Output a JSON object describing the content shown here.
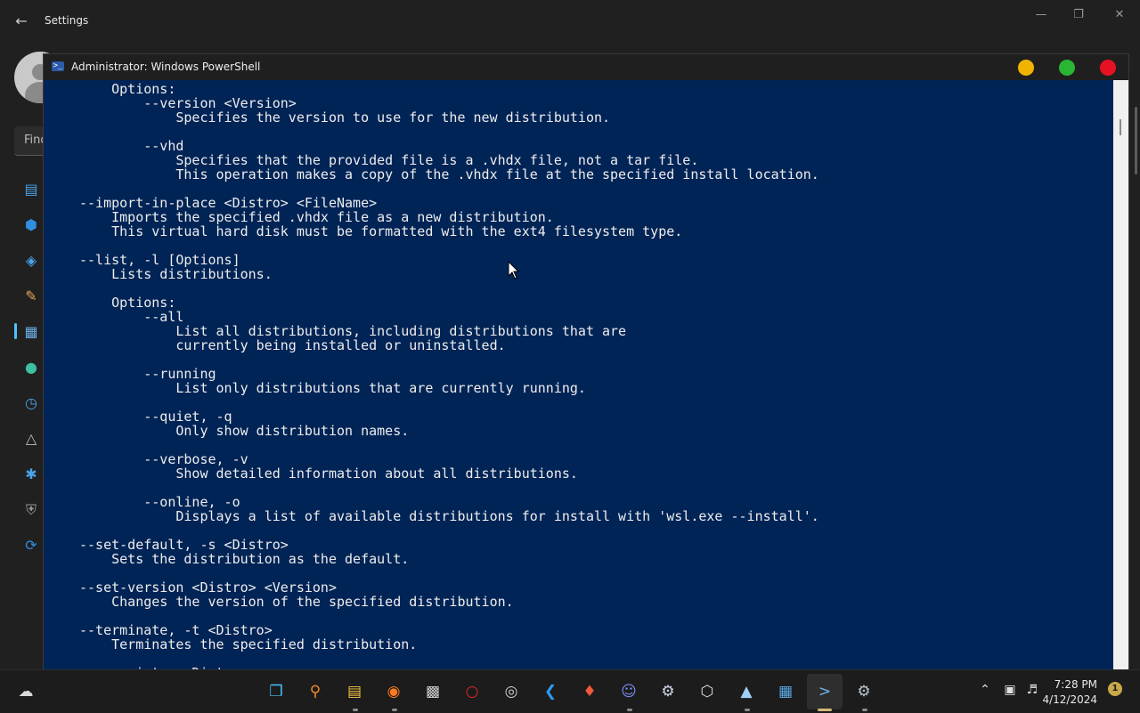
{
  "settings": {
    "title": "Settings",
    "search_placeholder": "Find"
  },
  "powershell": {
    "title": "Administrator: Windows PowerShell",
    "lines": [
      "    Options:",
      "        --version <Version>",
      "            Specifies the version to use for the new distribution.",
      "",
      "        --vhd",
      "            Specifies that the provided file is a .vhdx file, not a tar file.",
      "            This operation makes a copy of the .vhdx file at the specified install location.",
      "",
      "--import-in-place <Distro> <FileName>",
      "    Imports the specified .vhdx file as a new distribution.",
      "    This virtual hard disk must be formatted with the ext4 filesystem type.",
      "",
      "--list, -l [Options]",
      "    Lists distributions.",
      "",
      "    Options:",
      "        --all",
      "            List all distributions, including distributions that are",
      "            currently being installed or uninstalled.",
      "",
      "        --running",
      "            List only distributions that are currently running.",
      "",
      "        --quiet, -q",
      "            Only show distribution names.",
      "",
      "        --verbose, -v",
      "            Show detailed information about all distributions.",
      "",
      "        --online, -o",
      "            Displays a list of available distributions for install with 'wsl.exe --install'.",
      "",
      "--set-default, -s <Distro>",
      "    Sets the distribution as the default.",
      "",
      "--set-version <Distro> <Version>",
      "    Changes the version of the specified distribution.",
      "",
      "--terminate, -t <Distro>",
      "    Terminates the specified distribution.",
      "",
      "--unregister <Distro>"
    ]
  },
  "taskbar": {
    "time": "7:28 PM",
    "date": "4/12/2024",
    "notification_count": "1"
  },
  "colors": {
    "terminal_bg": "#012456",
    "mac_minimize": "#f0b400",
    "mac_maximize": "#2bb534",
    "mac_close": "#e81123"
  }
}
